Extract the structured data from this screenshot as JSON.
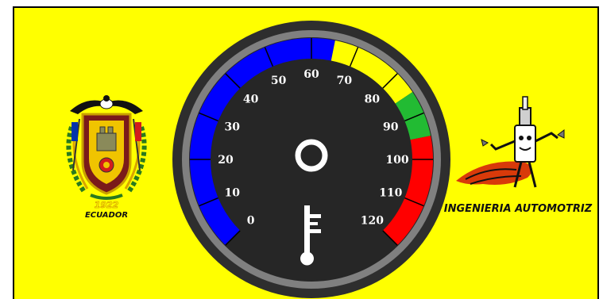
{
  "colors": {
    "background": "#ffff00",
    "bezel_outer": "#2e2e2e",
    "bezel_ring": "#808080",
    "dial_face": "#262626",
    "band_cold": "#0000ff",
    "band_warm": "#ffff00",
    "band_ok": "#22bb33",
    "band_hot": "#ff0000",
    "scale_text": "#ffffff"
  },
  "gauge": {
    "name": "temperature-gauge",
    "min": 0,
    "max": 120,
    "bands": [
      {
        "from": 0,
        "to": 65,
        "color": "#0000ff"
      },
      {
        "from": 65,
        "to": 85,
        "color": "#ffff00"
      },
      {
        "from": 85,
        "to": 95,
        "color": "#22bb33"
      },
      {
        "from": 95,
        "to": 120,
        "color": "#ff0000"
      }
    ],
    "scale_labels": [
      "0",
      "10",
      "20",
      "30",
      "40",
      "50",
      "60",
      "70",
      "80",
      "90",
      "100",
      "110",
      "120"
    ],
    "center_icon": "ring-icon",
    "bottom_icon": "thermometer-icon"
  },
  "left_logo": {
    "icon": "ecuador-coat-of-arms-icon",
    "year": "1922",
    "country": "ECUADOR"
  },
  "right_logo": {
    "icon": "spark-plug-mascot-icon",
    "caption": "INGENIERIA AUTOMOTRIZ"
  }
}
